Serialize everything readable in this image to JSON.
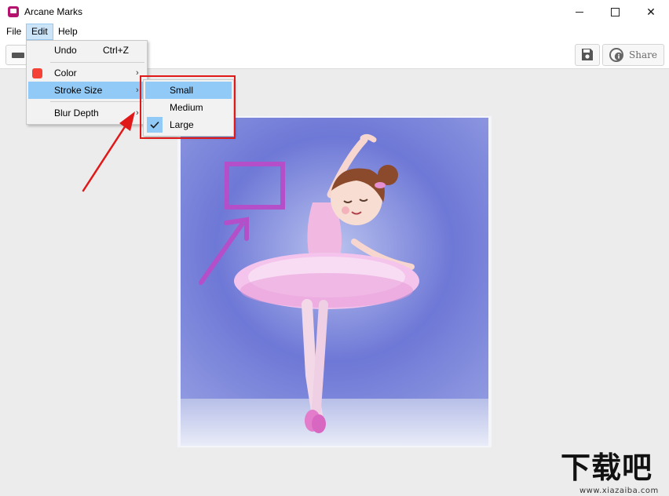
{
  "window": {
    "title": "Arcane Marks",
    "close_glyph": "✕"
  },
  "menubar": {
    "file": "File",
    "edit": "Edit",
    "help": "Help"
  },
  "toolbar": {
    "share_label": "Share"
  },
  "edit_menu": {
    "undo_label": "Undo",
    "undo_shortcut": "Ctrl+Z",
    "color_label": "Color",
    "color_swatch": "#f44336",
    "stroke_size_label": "Stroke Size",
    "blur_depth_label": "Blur Depth",
    "submenu_arrow": "›"
  },
  "stroke_submenu": {
    "items": [
      {
        "label": "Small",
        "highlighted": true,
        "checked": false
      },
      {
        "label": "Medium",
        "highlighted": false,
        "checked": false
      },
      {
        "label": "Large",
        "highlighted": false,
        "checked": true
      }
    ]
  },
  "canvas": {
    "image_description": "ballerina-illustration",
    "annotation_rect_color": "#b44fc9",
    "annotation_arrow_color": "#b44fc9"
  },
  "callout": {
    "highlight_color": "#e11818"
  },
  "watermark": {
    "text": "下载吧",
    "url": "www.xiazaiba.com"
  }
}
